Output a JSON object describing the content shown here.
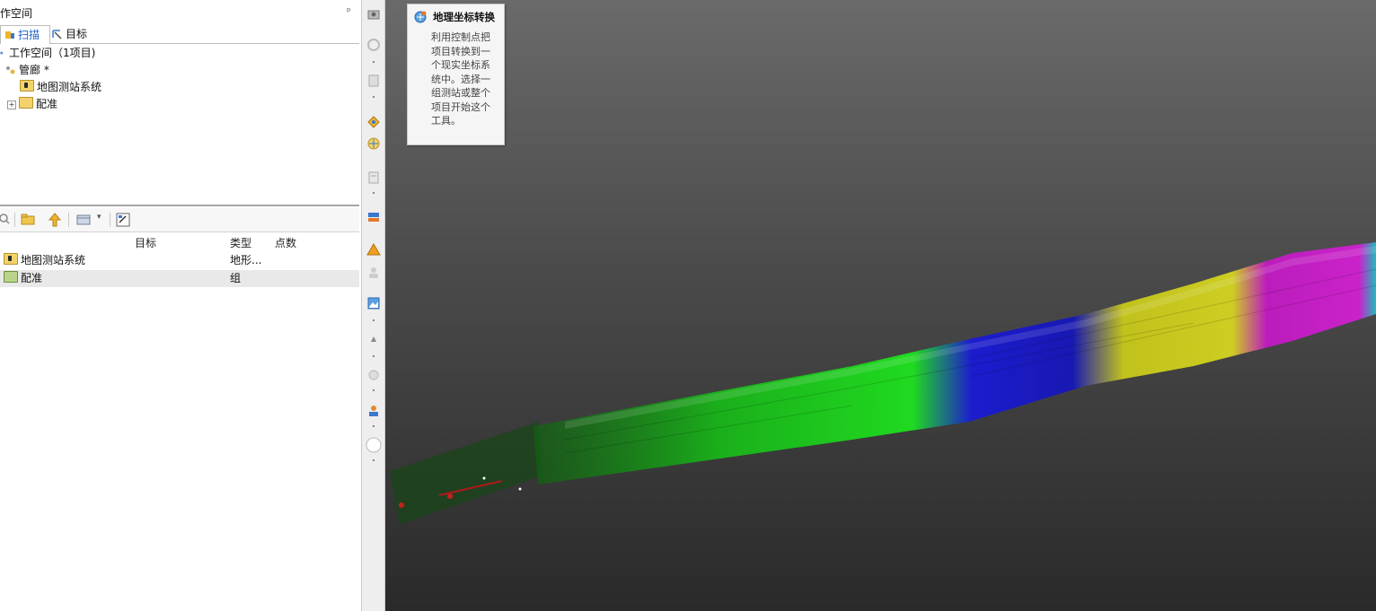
{
  "panel": {
    "title": "作空间",
    "pin": "ᵖ",
    "tabs": [
      {
        "label": "扫描"
      },
      {
        "label": "目标"
      }
    ]
  },
  "tree": {
    "root": "工作空间（1项目)",
    "project": "管廊 *",
    "items": [
      "地图测站系统",
      "配准"
    ]
  },
  "table": {
    "headers": [
      "目标",
      "类型",
      "点数"
    ],
    "rows": [
      {
        "name": "地图测站系统",
        "type": "地形...",
        "count": ""
      },
      {
        "name": "配准",
        "type": "组",
        "count": ""
      }
    ]
  },
  "tooltip": {
    "title": "地理坐标转换",
    "lines": [
      "利用控制点把",
      "项目转换到一",
      "个现实坐标系",
      "统中。选择一",
      "组测站或整个",
      "项目开始这个",
      "工具。"
    ]
  },
  "colors": {
    "accent": "#1a62c8",
    "cloud_green": "#1fd11f",
    "cloud_blue": "#1a1ad6",
    "cloud_yellow": "#c8c81a",
    "cloud_magenta": "#c21ac2",
    "cloud_cyan": "#1ac2c2"
  }
}
